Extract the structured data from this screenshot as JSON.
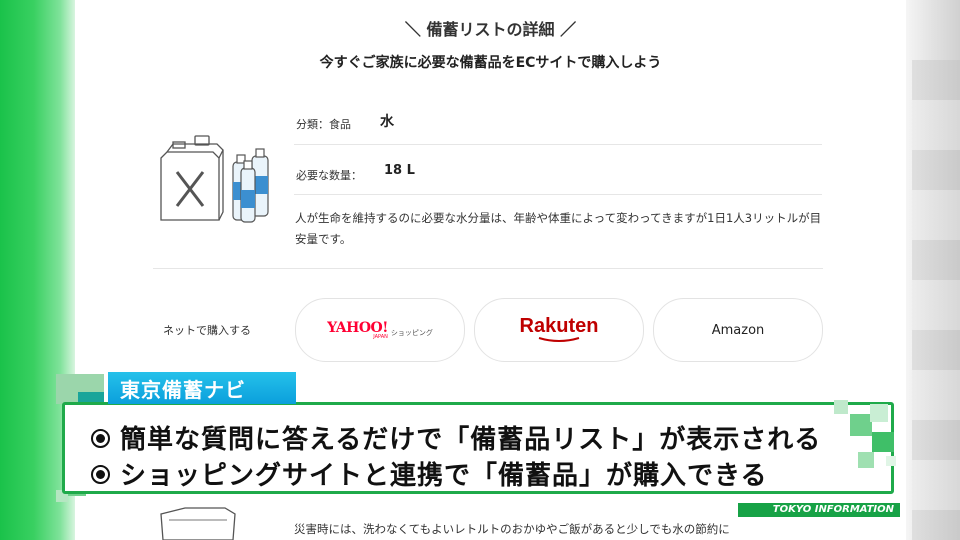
{
  "page": {
    "section_title": "＼ 備蓄リストの詳細 ／",
    "section_subtitle": "今すぐご家族に必要な備蓄品をECサイトで購入しよう",
    "item": {
      "category_label": "分類：食品",
      "name": "水",
      "quantity_label": "必要な数量：",
      "quantity_value": "18 L",
      "description": "人が生命を維持するのに必要な水分量は、年齢や体重によって変わってきますが1日1人3リットルが目安量です。"
    },
    "buy": {
      "label": "ネットで購入する",
      "shops": [
        {
          "name_main": "YAHOO!",
          "name_sub": "ショッピング",
          "japan": "JAPAN"
        },
        {
          "name_main": "Rakuten"
        },
        {
          "name_main": "Amazon"
        }
      ]
    },
    "bottom_text": "災害時には、洗わなくてもよいレトルトのおかゆやご飯があると少しでも水の節約に"
  },
  "overlay": {
    "tag": "東京備蓄ナビ",
    "line1": "簡単な質問に答えるだけで「備蓄品リスト」が表示される",
    "line2": "ショッピングサイトと連携で「備蓄品」が購入できる",
    "footer": "TOKYO INFORMATION"
  },
  "colors": {
    "green": "#1faa4a",
    "caption_tag": "#0b9fdc",
    "yahoo_red": "#ff0033",
    "rakuten_red": "#bf0000"
  },
  "icons": [
    "water-tank-icon",
    "water-bottle-icon",
    "bullet-icon"
  ]
}
